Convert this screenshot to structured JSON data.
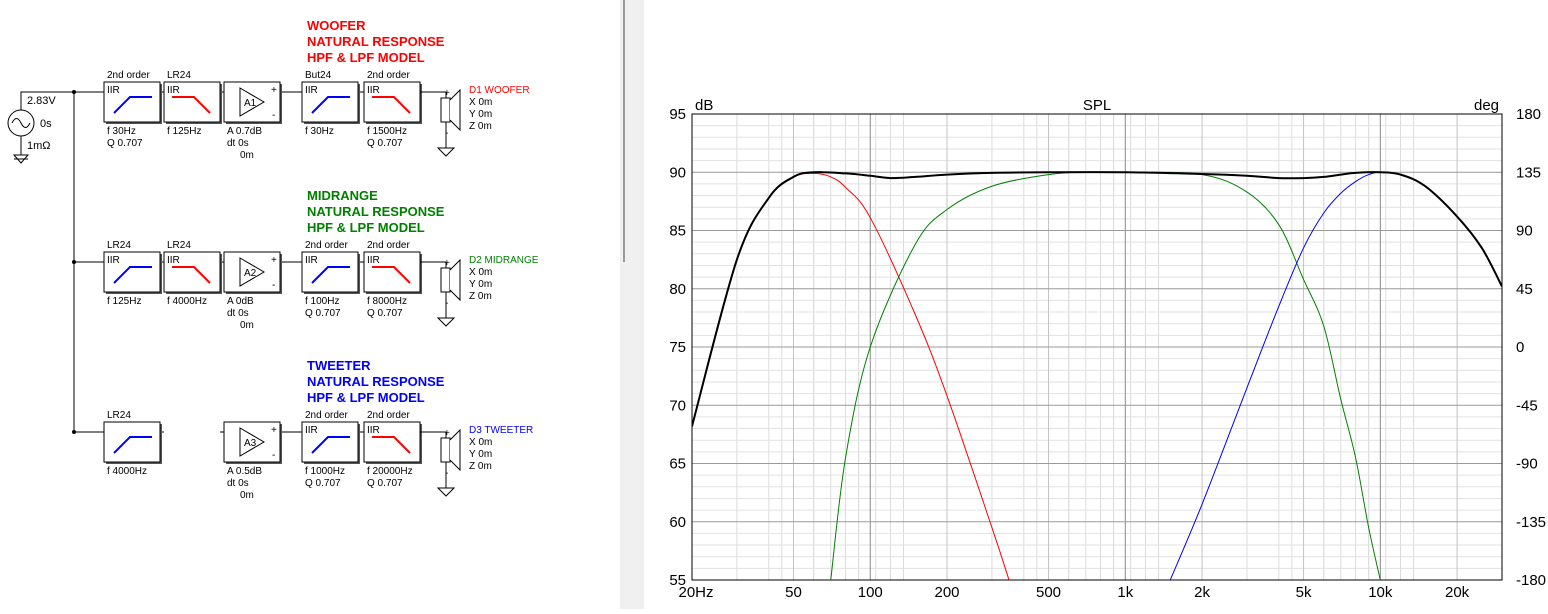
{
  "source": {
    "voltage": "2.83V",
    "delay": "0s",
    "resistance": "1mΩ"
  },
  "chains": [
    {
      "key": "woofer",
      "color": "#ff0000",
      "title": [
        "WOOFER",
        "NATURAL RESPONSE",
        "HPF & LPF MODEL"
      ],
      "blocks": [
        {
          "kind": "hp",
          "top": "2nd order",
          "tag": "IIR",
          "p1": "f  30Hz",
          "p2": "Q  0.707"
        },
        {
          "kind": "lp",
          "top": "LR24",
          "tag": "IIR",
          "p1": "f  125Hz",
          "p2": ""
        },
        {
          "kind": "amp",
          "name": "A1",
          "p1": "A  0.7dB",
          "p2": "dt 0s",
          "p3": "0m"
        },
        {
          "kind": "hp",
          "top": "But24",
          "tag": "IIR",
          "p1": "f  30Hz",
          "p2": ""
        },
        {
          "kind": "lp",
          "top": "2nd order",
          "tag": "IIR",
          "p1": "f  1500Hz",
          "p2": "Q  0.707"
        }
      ],
      "driver": {
        "name": "D1 WOOFER",
        "x": "X 0m",
        "y": "Y 0m",
        "z": "Z 0m"
      }
    },
    {
      "key": "midrange",
      "color": "#008000",
      "title": [
        "MIDRANGE",
        "NATURAL RESPONSE",
        "HPF & LPF MODEL"
      ],
      "blocks": [
        {
          "kind": "hp",
          "top": "LR24",
          "tag": "IIR",
          "p1": "f  125Hz",
          "p2": ""
        },
        {
          "kind": "lp",
          "top": "LR24",
          "tag": "IIR",
          "p1": "f  4000Hz",
          "p2": ""
        },
        {
          "kind": "amp",
          "name": "A2",
          "p1": "A  0dB",
          "p2": "dt 0s",
          "p3": "0m"
        },
        {
          "kind": "hp",
          "top": "2nd order",
          "tag": "IIR",
          "p1": "f  100Hz",
          "p2": "Q  0.707"
        },
        {
          "kind": "lp",
          "top": "2nd order",
          "tag": "IIR",
          "p1": "f  8000Hz",
          "p2": "Q  0.707"
        }
      ],
      "driver": {
        "name": "D2 MIDRANGE",
        "x": "X 0m",
        "y": "Y 0m",
        "z": "Z 0m"
      }
    },
    {
      "key": "tweeter",
      "color": "#0000ff",
      "title": [
        "TWEETER",
        "NATURAL RESPONSE",
        "HPF & LPF MODEL"
      ],
      "blocks": [
        {
          "kind": "hp",
          "top": "LR24",
          "tag": "",
          "p1": "f  4000Hz",
          "p2": ""
        },
        null,
        {
          "kind": "amp",
          "name": "A3",
          "p1": "A  0.5dB",
          "p2": "dt 0s",
          "p3": "0m"
        },
        {
          "kind": "hp",
          "top": "2nd order",
          "tag": "IIR",
          "p1": "f  1000Hz",
          "p2": "Q  0.707"
        },
        {
          "kind": "lp",
          "top": "2nd order",
          "tag": "IIR",
          "p1": "f  20000Hz",
          "p2": "Q  0.707"
        }
      ],
      "driver": {
        "name": "D3 TWEETER",
        "x": "X 0m",
        "y": "Y 0m",
        "z": "Z 0m"
      }
    }
  ],
  "chart_data": {
    "type": "line",
    "title": "SPL",
    "ylabel": "dB",
    "y2label": "deg",
    "xscale": "log",
    "xlim": [
      20,
      30000
    ],
    "ylim": [
      55,
      95
    ],
    "y2lim": [
      -180,
      180
    ],
    "xticks": [
      {
        "v": 20,
        "label": "20Hz"
      },
      {
        "v": 50,
        "label": "50"
      },
      {
        "v": 100,
        "label": "100"
      },
      {
        "v": 200,
        "label": "200"
      },
      {
        "v": 500,
        "label": "500"
      },
      {
        "v": 1000,
        "label": "1k"
      },
      {
        "v": 2000,
        "label": "2k"
      },
      {
        "v": 5000,
        "label": "5k"
      },
      {
        "v": 10000,
        "label": "10k"
      },
      {
        "v": 20000,
        "label": "20k"
      }
    ],
    "yticks": [
      95,
      90,
      85,
      80,
      75,
      70,
      65,
      60,
      55
    ],
    "y2ticks": [
      180,
      135,
      90,
      45,
      0,
      -45,
      -90,
      -135,
      -180
    ],
    "grid": true,
    "series": [
      {
        "color": "#ff0000",
        "x": [
          20,
          30,
          40,
          50,
          60,
          70,
          80,
          100,
          150,
          200,
          300,
          350
        ],
        "y": [
          68.2,
          82.5,
          87.8,
          89.6,
          89.9,
          89.6,
          88.7,
          86.1,
          77.8,
          70.8,
          59.5,
          55
        ]
      },
      {
        "color": "#008000",
        "x": [
          70,
          80,
          100,
          150,
          200,
          300,
          500,
          700,
          1000,
          2000,
          3000,
          4000,
          5000,
          6000,
          7000,
          8000,
          9000,
          10000
        ],
        "y": [
          55,
          65.5,
          75,
          83.8,
          86.8,
          88.8,
          89.8,
          90,
          90,
          89.8,
          88.3,
          85.5,
          80.8,
          76.8,
          70.5,
          65.5,
          59.5,
          55
        ]
      },
      {
        "color": "#0000ff",
        "x": [
          1500,
          2000,
          3000,
          4000,
          5000,
          6000,
          7000,
          8000,
          9000,
          10000,
          12000,
          15000,
          20000,
          25000,
          30000
        ],
        "y": [
          55,
          61.5,
          71.5,
          78.5,
          83.5,
          86.5,
          88.2,
          89.2,
          89.8,
          90,
          89.8,
          88.8,
          86.2,
          83.5,
          80.2
        ]
      },
      {
        "color": "#000000",
        "x": [
          20,
          30,
          40,
          50,
          60,
          80,
          100,
          120,
          150,
          200,
          300,
          500,
          1000,
          2000,
          3000,
          4000,
          5000,
          6000,
          7000,
          8000,
          10000,
          12000,
          15000,
          20000,
          25000,
          30000
        ],
        "y": [
          68.2,
          82.5,
          87.8,
          89.6,
          90,
          89.9,
          89.7,
          89.5,
          89.6,
          89.8,
          89.95,
          90,
          90,
          89.85,
          89.7,
          89.5,
          89.5,
          89.6,
          89.8,
          89.95,
          90,
          89.8,
          88.8,
          86.2,
          83.5,
          80.2
        ]
      }
    ]
  }
}
